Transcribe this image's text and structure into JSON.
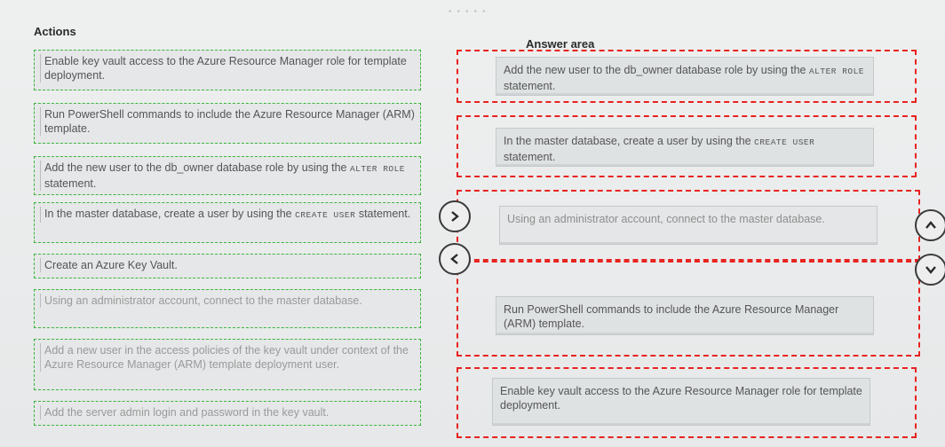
{
  "actions_heading": "Actions",
  "answer_heading": "Answer area",
  "actions": [
    {
      "text": "Enable key vault access to the Azure Resource Manager role for template deployment."
    },
    {
      "text": "Run PowerShell commands to include the Azure Resource Manager (ARM) template."
    },
    {
      "pre": "Add the new user to the db_owner database role by using the ",
      "code": "ALTER ROLE",
      "post": " statement."
    },
    {
      "pre": "In the master database, create a user by using the ",
      "code": "CREATE USER",
      "post": " statement."
    },
    {
      "text": "Create an Azure Key Vault."
    },
    {
      "text": "Using an administrator account, connect to the master database."
    },
    {
      "text": "Add a new user in the access policies of the key vault under context of the Azure Resource Manager (ARM) template deployment user."
    },
    {
      "text": "Add the server admin login and password in the key vault."
    }
  ],
  "answers": [
    {
      "pre": "Add the new user to the db_owner database role by using the ",
      "code": "ALTER ROLE",
      "post": " statement."
    },
    {
      "pre": "In the master database, create a user by using the ",
      "code": "CREATE USER",
      "post": " statement."
    },
    {
      "text": "Using an administrator account, connect to the master database."
    },
    {
      "text": "Run PowerShell commands to include the Azure Resource Manager (ARM) template."
    },
    {
      "text": "Enable key vault access to the Azure Resource Manager role for template deployment."
    }
  ],
  "icons": {
    "move_right": "chevron-right-icon",
    "move_left": "chevron-left-icon",
    "move_up": "chevron-up-icon",
    "move_down": "chevron-down-icon"
  },
  "colors": {
    "action_border": "#3cb43c",
    "answer_zone_border": "#e8231f"
  }
}
